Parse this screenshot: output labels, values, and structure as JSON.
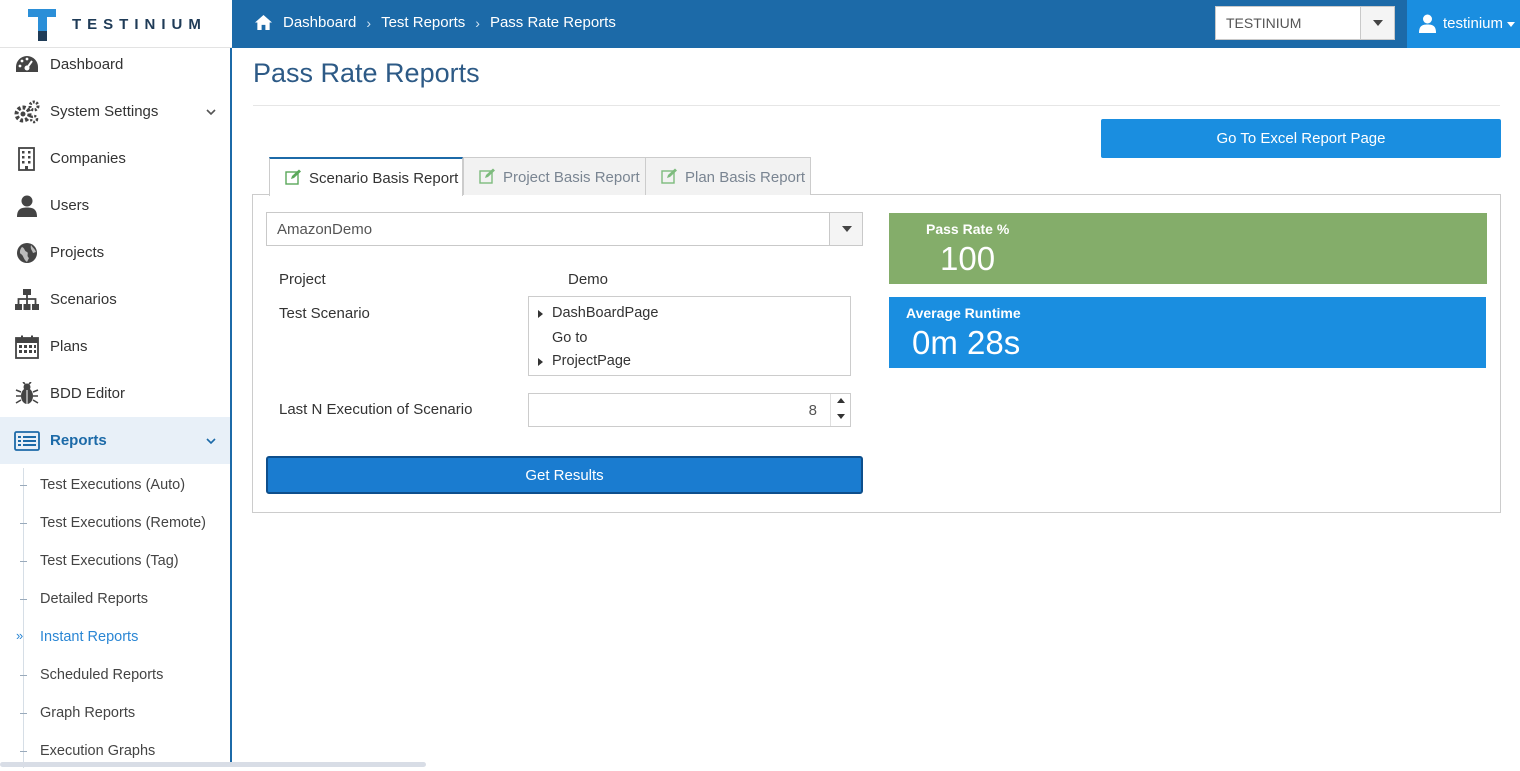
{
  "brand": {
    "name": "TESTINIUM"
  },
  "breadcrumb": [
    "Dashboard",
    "Test Reports",
    "Pass Rate Reports"
  ],
  "org_select": {
    "value": "TESTINIUM"
  },
  "user": {
    "name": "testinium"
  },
  "sidebar": {
    "items": [
      {
        "label": "Dashboard",
        "icon": "dashboard-icon"
      },
      {
        "label": "System Settings",
        "icon": "gears-icon"
      },
      {
        "label": "Companies",
        "icon": "building-icon"
      },
      {
        "label": "Users",
        "icon": "user-icon"
      },
      {
        "label": "Projects",
        "icon": "globe-icon"
      },
      {
        "label": "Scenarios",
        "icon": "sitemap-icon"
      },
      {
        "label": "Plans",
        "icon": "calendar-icon"
      },
      {
        "label": "BDD Editor",
        "icon": "bug-icon"
      },
      {
        "label": "Reports",
        "icon": "list-icon"
      }
    ],
    "reports_sub": [
      "Test Executions (Auto)",
      "Test Executions (Remote)",
      "Test Executions (Tag)",
      "Detailed Reports",
      "Instant Reports",
      "Scheduled Reports",
      "Graph Reports",
      "Execution Graphs"
    ]
  },
  "page": {
    "title": "Pass Rate Reports",
    "excel_button": "Go To Excel Report Page",
    "tabs": [
      "Scenario Basis Report",
      "Project Basis Report",
      "Plan Basis Report"
    ],
    "scenario_select": "AmazonDemo",
    "project_label": "Project",
    "project_value": "Demo",
    "test_scenario_label": "Test Scenario",
    "tree": [
      "DashBoardPage",
      "Go to",
      "ProjectPage"
    ],
    "last_n_label": "Last N Execution of Scenario",
    "last_n_value": "8",
    "get_results": "Get Results"
  },
  "stats": {
    "pass_rate_title": "Pass Rate %",
    "pass_rate_value": "100",
    "runtime_title": "Average Runtime",
    "runtime_value": "0m 28s"
  },
  "colors": {
    "topbar": "#1c6aa8",
    "accent": "#1a8ee0",
    "pass_green": "#84ad6a",
    "runtime_blue": "#1a8ee0"
  }
}
